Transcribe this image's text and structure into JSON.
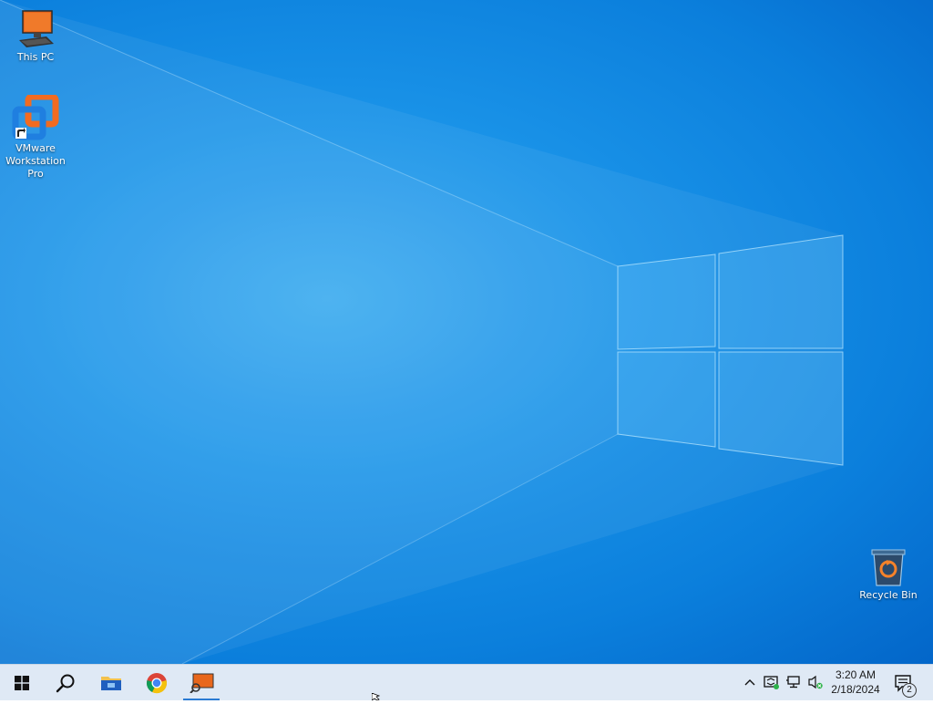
{
  "desktop": {
    "icons": [
      {
        "label": "This PC",
        "icon": "computer-icon"
      },
      {
        "label": "VMware Workstation Pro",
        "icon": "vmware-icon"
      },
      {
        "label": "Recycle Bin",
        "icon": "recycle-bin-icon"
      }
    ]
  },
  "taskbar": {
    "pinned": [
      {
        "name": "Start",
        "icon": "windows-logo-icon"
      },
      {
        "name": "Search",
        "icon": "search-icon"
      },
      {
        "name": "File Explorer",
        "icon": "folder-icon"
      },
      {
        "name": "Chrome",
        "icon": "chrome-icon"
      },
      {
        "name": "Running app",
        "icon": "app-window-icon",
        "active": true
      }
    ],
    "tray": {
      "icons": [
        "chevron-up-icon",
        "defender-icon",
        "network-icon",
        "volume-muted-icon"
      ],
      "time": "3:20 AM",
      "date": "2/18/2024",
      "notification_count": "2"
    }
  },
  "colors": {
    "taskbar_bg": "#dfe9f5",
    "desktop_bg": "#1a93e8",
    "accent": "#2b7bd3"
  }
}
